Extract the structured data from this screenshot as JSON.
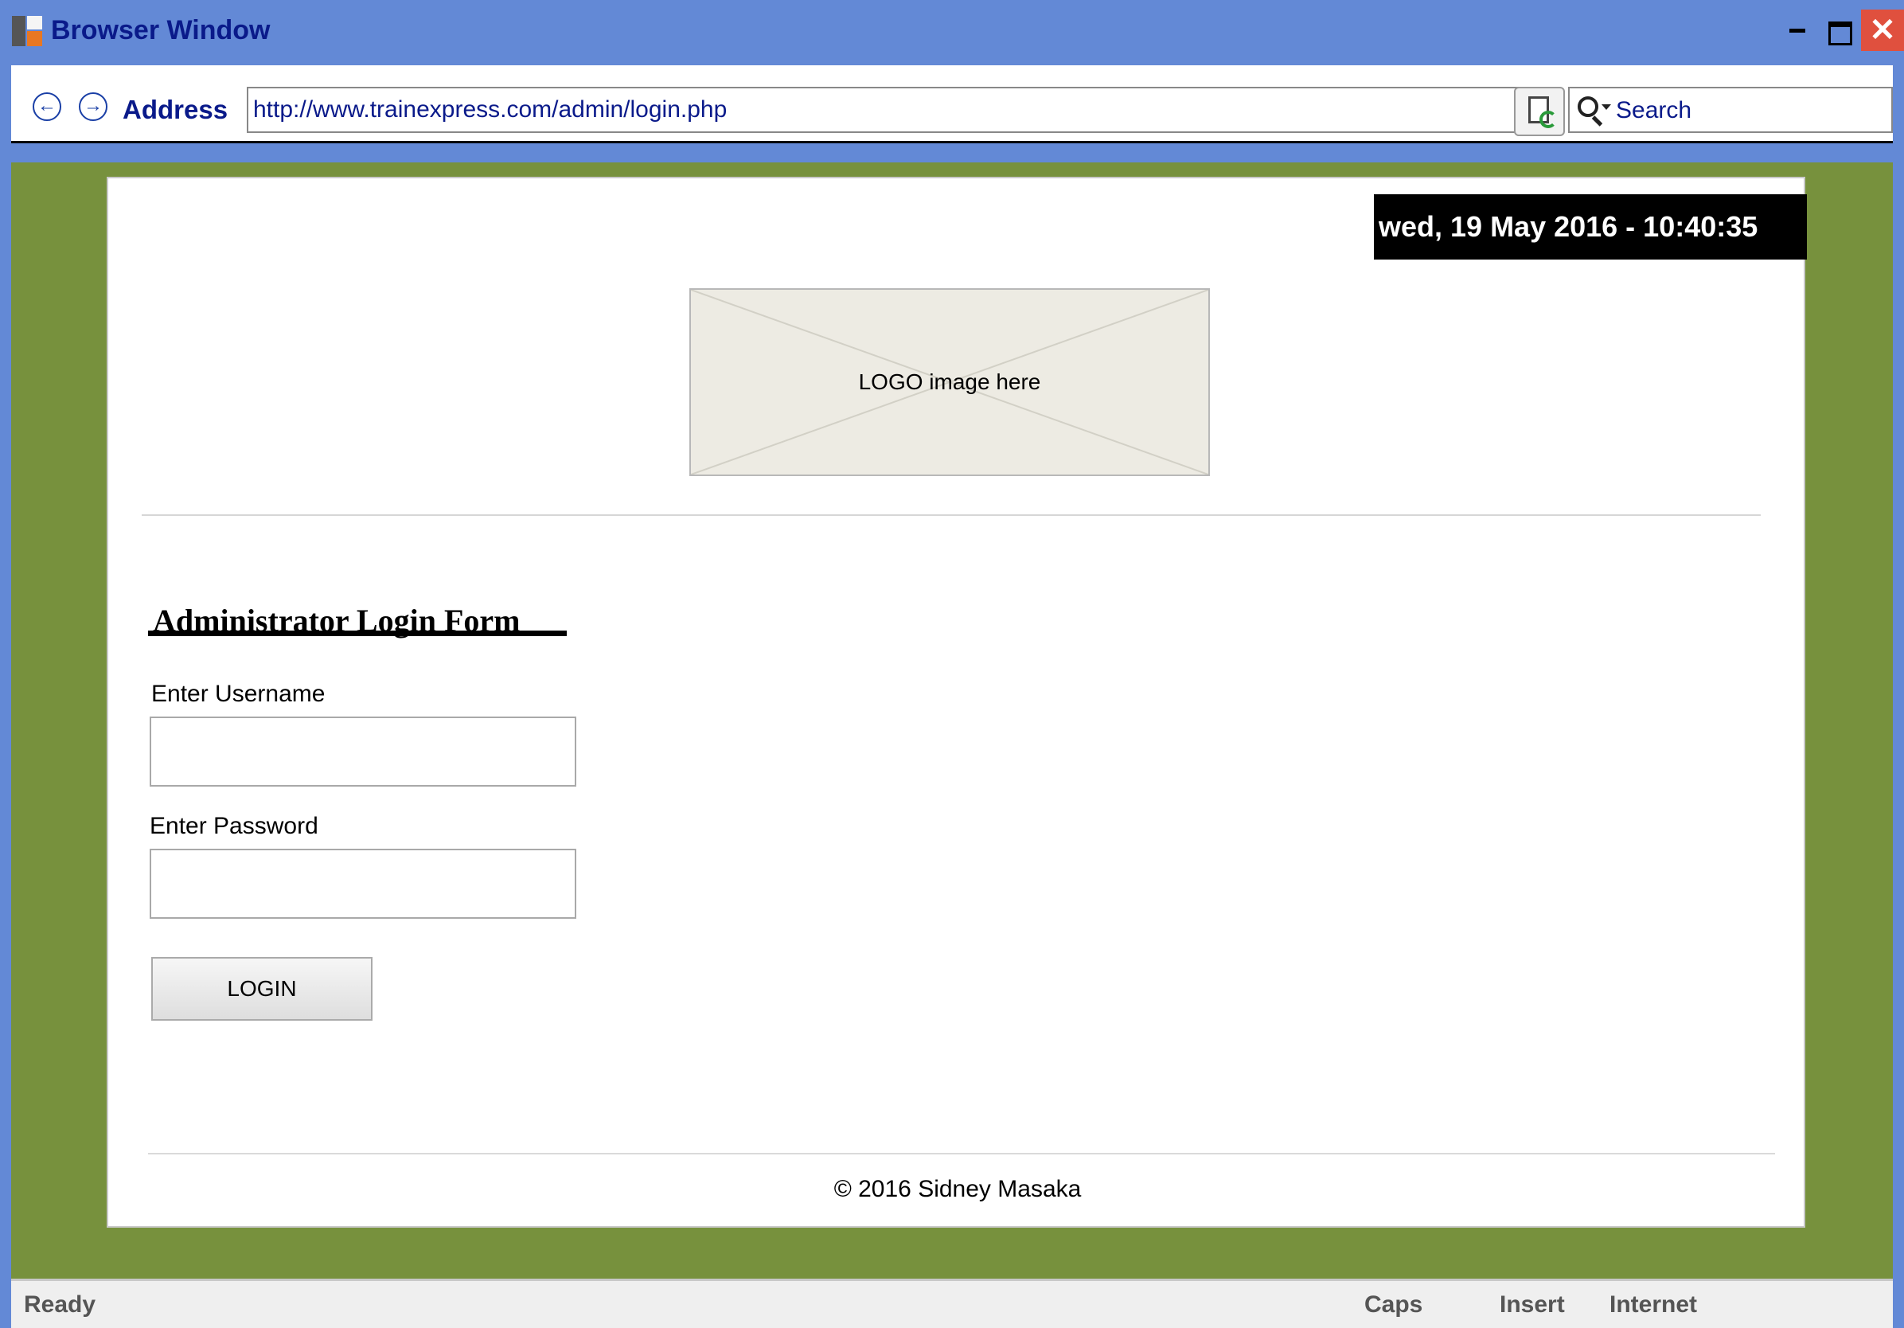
{
  "window": {
    "title": "Browser Window",
    "close_glyph": "✕"
  },
  "toolbar": {
    "back_glyph": "←",
    "forward_glyph": "→",
    "address_label": "Address",
    "url": "http://www.trainexpress.com/admin/login.php",
    "search_placeholder": "Search"
  },
  "page": {
    "datetime": "wed, 19 May 2016 - 10:40:35",
    "logo_label": "LOGO image here",
    "form": {
      "heading": "Administrator Login Form",
      "username_label": "Enter Username",
      "username_value": "",
      "password_label": "Enter Password",
      "password_value": "",
      "login_label": "LOGIN"
    },
    "footer": "© 2016 Sidney Masaka"
  },
  "statusbar": {
    "ready": "Ready",
    "caps": "Caps",
    "insert": "Insert",
    "internet": "Internet"
  },
  "colors": {
    "titlebar": "#6389d6",
    "title_text": "#0a1a8a",
    "close_button": "#e0503e",
    "content_background": "#77913d",
    "datetime_background": "#000000",
    "logo_placeholder": "#edebe3"
  },
  "icons": [
    "app-icon",
    "back-icon",
    "forward-icon",
    "refresh-icon",
    "search-icon",
    "minimize-icon",
    "maximize-icon",
    "close-icon"
  ]
}
